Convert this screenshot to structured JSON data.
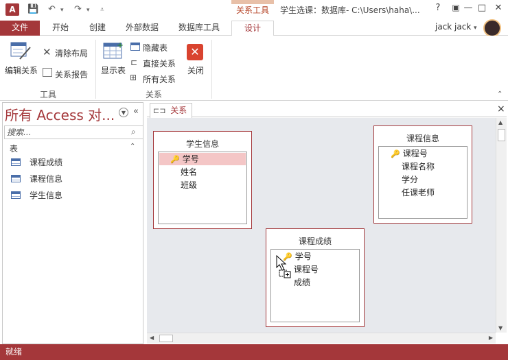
{
  "app": {
    "icon_text": "A",
    "window_title": "学生选课：数据库- C:\\Users\\haha\\...",
    "context_tab": "关系工具"
  },
  "window_buttons": {
    "help": "?",
    "minimize": "—",
    "maximize": "□",
    "close": "✕"
  },
  "tabs": [
    {
      "label": "文件"
    },
    {
      "label": "开始"
    },
    {
      "label": "创建"
    },
    {
      "label": "外部数据"
    },
    {
      "label": "数据库工具"
    },
    {
      "label": "设计"
    }
  ],
  "user": {
    "name": "jack jack"
  },
  "ribbon": {
    "tools": {
      "edit_relations": "编辑关系",
      "clear_layout": "清除布局",
      "relation_report": "关系报告",
      "group_label": "工具"
    },
    "relations": {
      "show_table": "显示表",
      "hide_table": "隐藏表",
      "direct_relations": "直接关系",
      "all_relations": "所有关系",
      "close": "关闭",
      "group_label": "关系"
    }
  },
  "nav": {
    "title": "所有 Access 对...",
    "search_placeholder": "搜索...",
    "section": "表",
    "items": [
      {
        "label": "课程成绩"
      },
      {
        "label": "课程信息"
      },
      {
        "label": "学生信息"
      }
    ]
  },
  "doc_tab": {
    "label": "关系",
    "close": "×"
  },
  "tables": [
    {
      "title": "学生信息",
      "fields": [
        "学号",
        "姓名",
        "班级"
      ]
    },
    {
      "title": "课程信息",
      "fields": [
        "课程号",
        "课程名称",
        "学分",
        "任课老师"
      ]
    },
    {
      "title": "课程成绩",
      "fields": [
        "学号",
        "课程号",
        "成绩"
      ]
    }
  ],
  "status": {
    "text": "就绪"
  },
  "colors": {
    "accent": "#a4373a",
    "canvas": "#e7e9ed"
  }
}
